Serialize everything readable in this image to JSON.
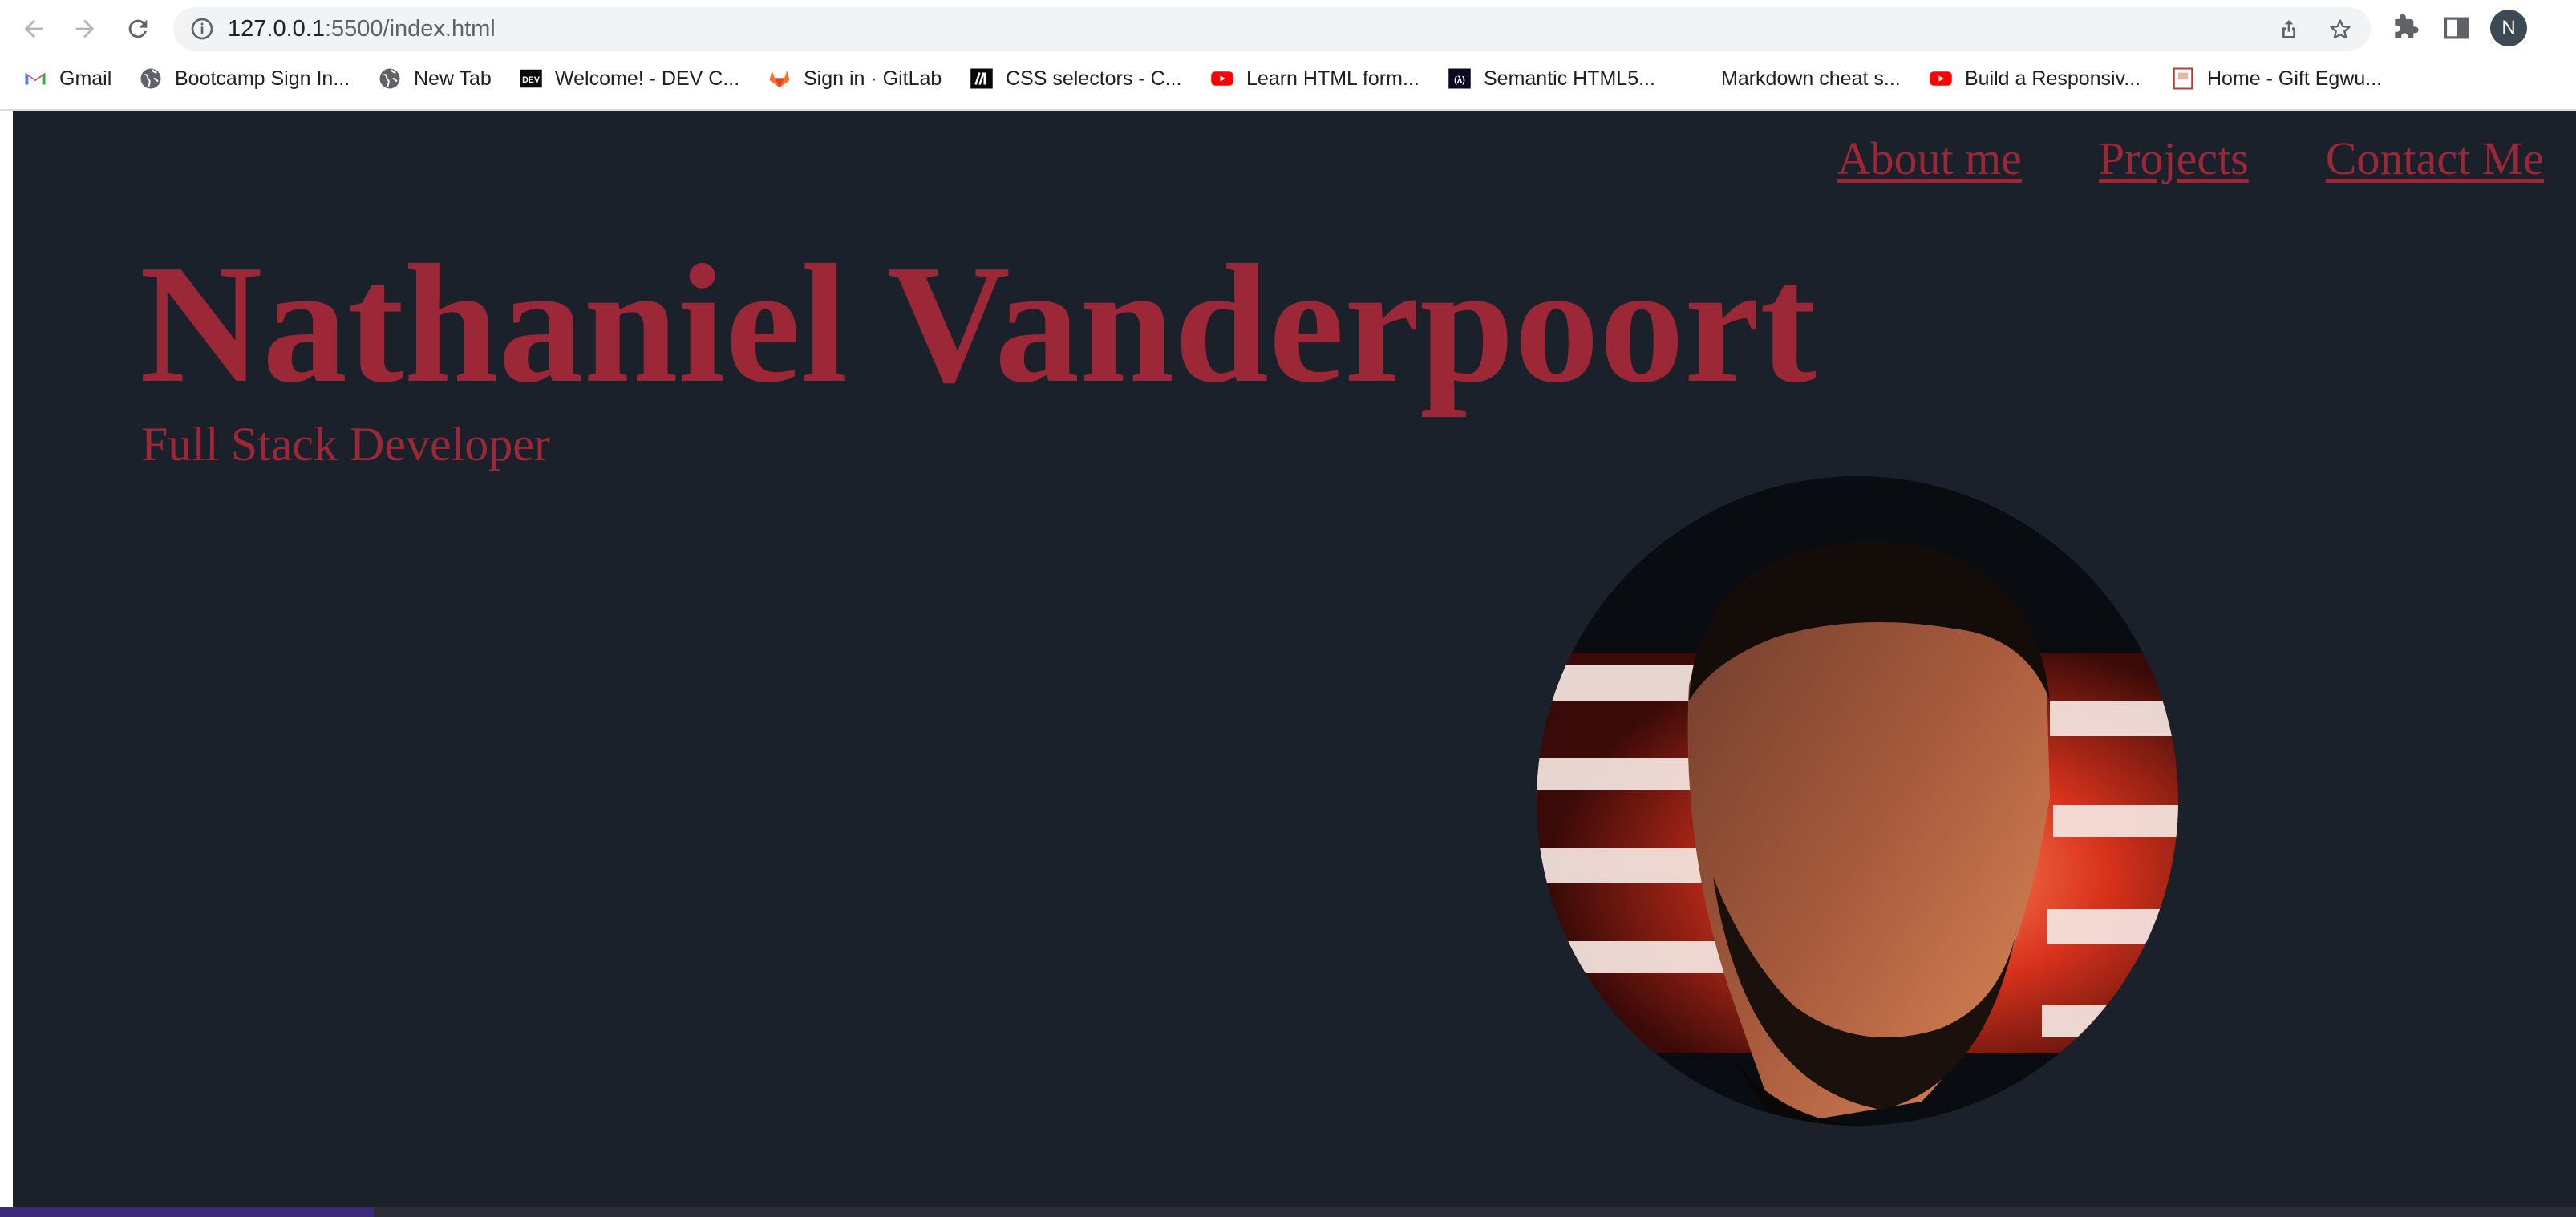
{
  "browser": {
    "url_host": "127.0.0.1",
    "url_path": ":5500/index.html",
    "profile_initial": "N",
    "bookmarks": [
      {
        "label": "Gmail",
        "icon": "gmail-icon"
      },
      {
        "label": "Bootcamp Sign In...",
        "icon": "globe-icon"
      },
      {
        "label": "New Tab",
        "icon": "globe-icon"
      },
      {
        "label": "Welcome! - DEV C...",
        "icon": "dev-icon"
      },
      {
        "label": "Sign in · GitLab",
        "icon": "gitlab-icon"
      },
      {
        "label": "CSS selectors - C...",
        "icon": "mdn-icon"
      },
      {
        "label": "Learn HTML form...",
        "icon": "youtube-icon"
      },
      {
        "label": "Semantic HTML5...",
        "icon": "freecodecamp-icon"
      },
      {
        "label": "Markdown cheat s...",
        "icon": "none"
      },
      {
        "label": "Build a Responsiv...",
        "icon": "youtube-icon"
      },
      {
        "label": "Home - Gift Egwu...",
        "icon": "page-icon"
      }
    ]
  },
  "site": {
    "nav": [
      "About me",
      "Projects",
      "Contact Me"
    ],
    "name": "Nathaniel Vanderpoort",
    "role": "Full Stack Developer",
    "colors": {
      "background": "#1a212b",
      "accent": "#9b2737"
    }
  }
}
